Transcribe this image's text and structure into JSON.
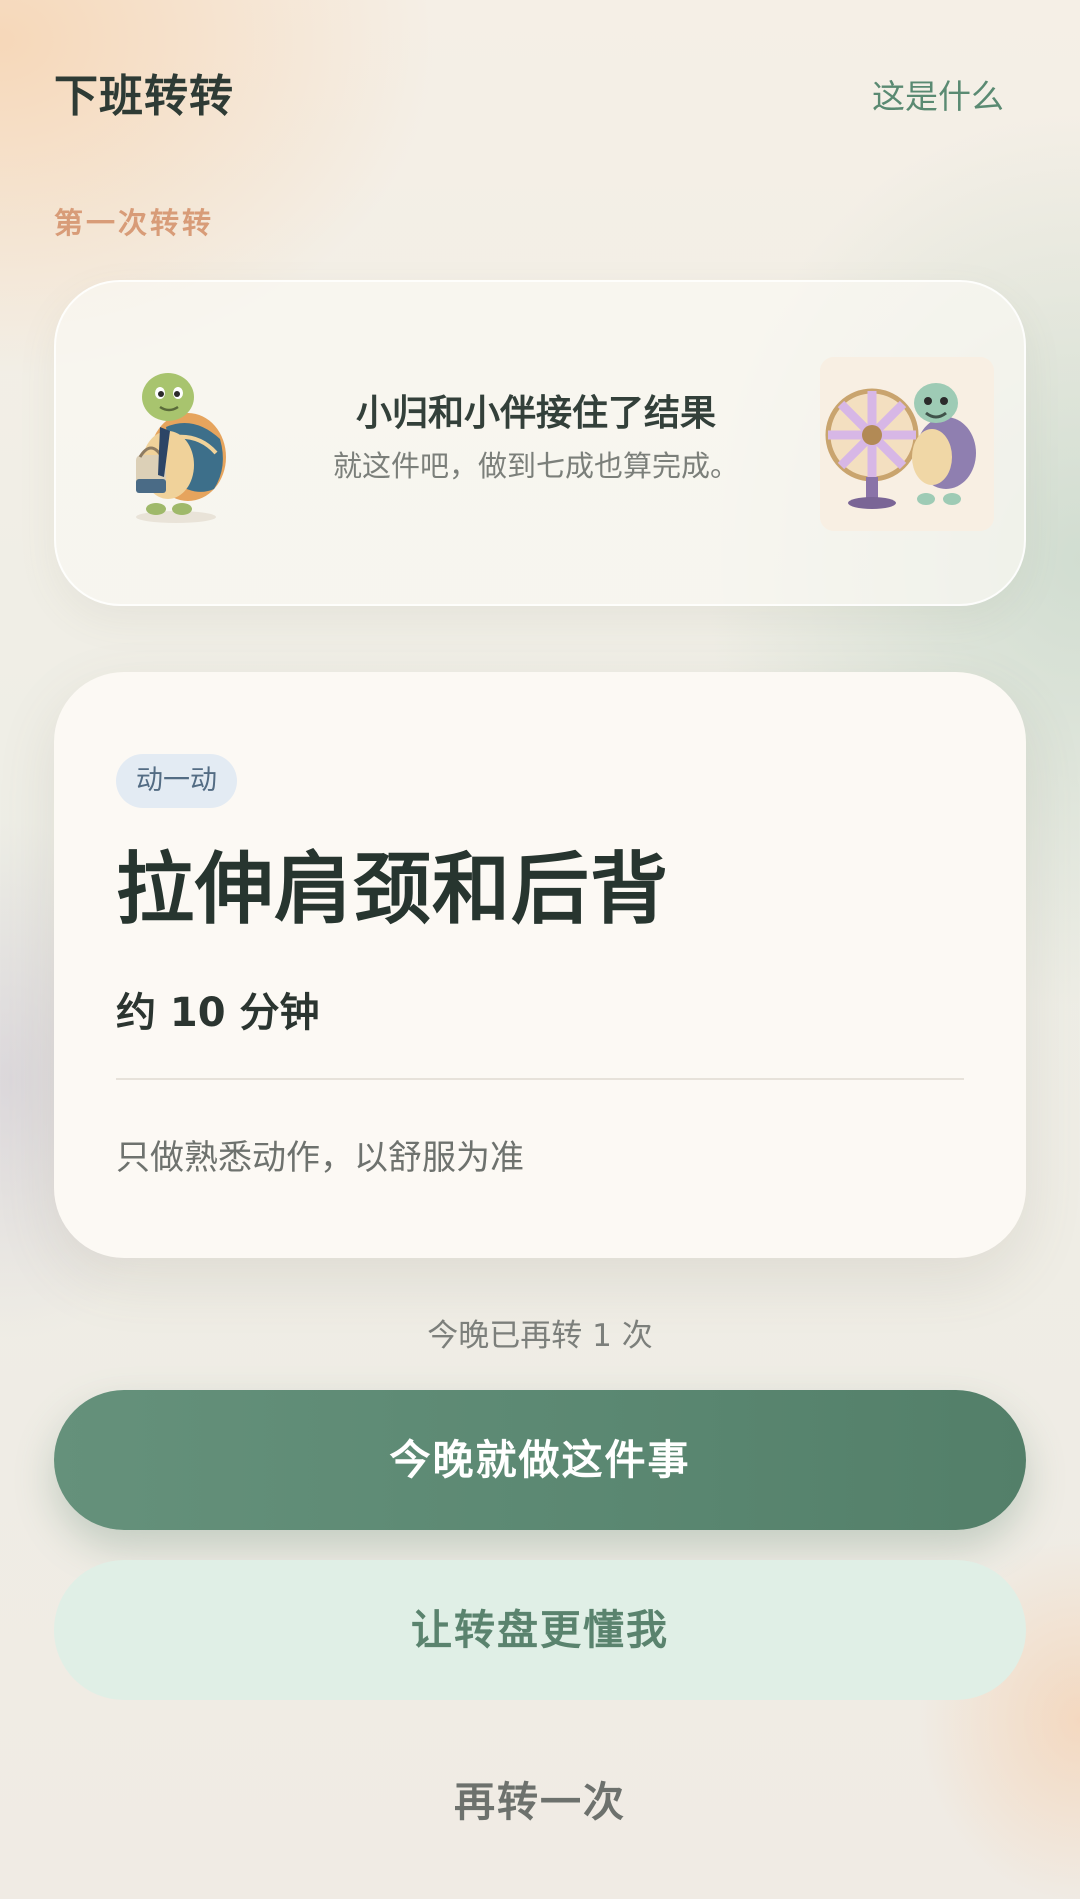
{
  "header": {
    "app_title": "下班转转",
    "help_link": "这是什么"
  },
  "section_label": "第一次转转",
  "notice": {
    "title": "小归和小伴接住了结果",
    "subtitle": "就这件吧，做到七成也算完成。",
    "mascot_left_icon": "turtle-with-tote-bag-icon",
    "mascot_right_icon": "turtle-with-wheel-icon"
  },
  "result": {
    "category": "动一动",
    "title": "拉伸肩颈和后背",
    "duration": "约 10 分钟",
    "note": "只做熟悉动作，以舒服为准"
  },
  "spin_count_text": "今晚已再转 1 次",
  "buttons": {
    "primary": "今晚就做这件事",
    "secondary": "让转盘更懂我",
    "tertiary": "再转一次"
  },
  "colors": {
    "accent_green": "#5b8872",
    "section_label_orange": "#d89c78",
    "badge_bg": "#e3ebf3",
    "secondary_bg": "#e0efe6"
  }
}
